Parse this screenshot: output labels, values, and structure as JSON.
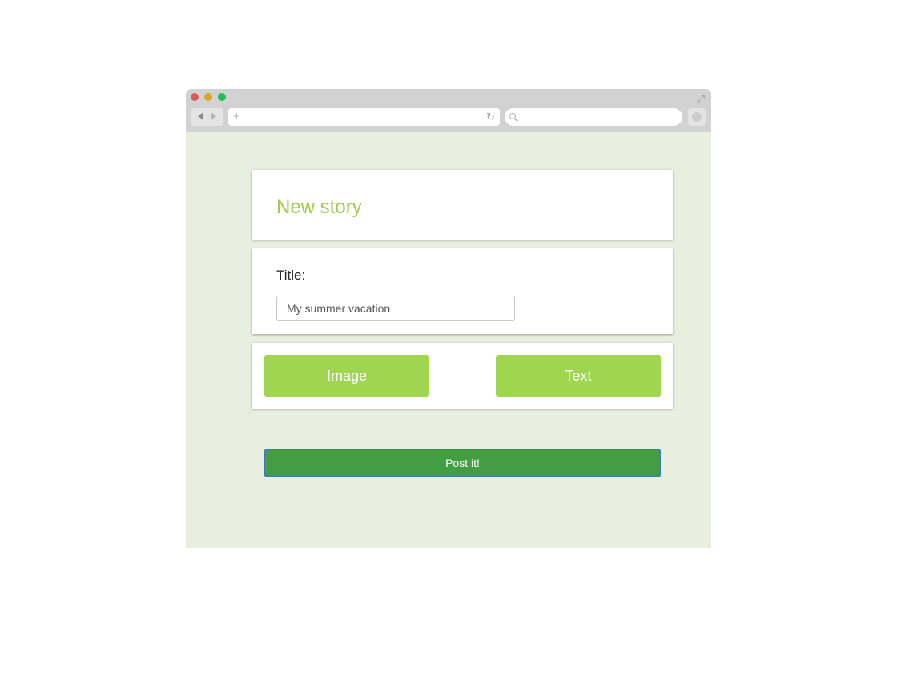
{
  "browser": {
    "window_controls": [
      "close",
      "minimize",
      "maximize"
    ],
    "icons": {
      "back": "back-arrow-icon",
      "forward": "forward-arrow-icon",
      "new_tab": "plus-icon",
      "reload": "reload-icon",
      "search": "search-icon",
      "expand": "expand-icon",
      "extension": "extension-icon"
    },
    "url_value": "",
    "search_value": ""
  },
  "page": {
    "heading": "New story",
    "title_label": "Title:",
    "title_input_value": "My summer vacation",
    "buttons": {
      "image": "Image",
      "text": "Text",
      "post": "Post it!"
    }
  },
  "colors": {
    "background": "#e9efdf",
    "heading": "#9fcc4a",
    "type_button": "#a0d64f",
    "post_button": "#439d43",
    "post_button_border": "#3a78c4"
  }
}
